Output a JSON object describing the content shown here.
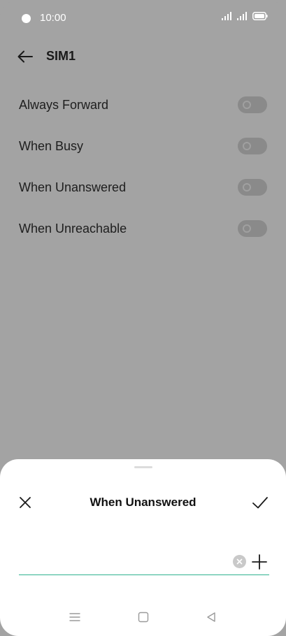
{
  "status_bar": {
    "time": "10:00",
    "icons": [
      "signal-icon",
      "signal-icon",
      "battery-icon"
    ]
  },
  "header": {
    "back_icon": "arrow-left-icon",
    "title": "SIM1"
  },
  "settings": {
    "items": [
      {
        "label": "Always Forward",
        "enabled": false
      },
      {
        "label": "When Busy",
        "enabled": false
      },
      {
        "label": "When Unanswered",
        "enabled": false
      },
      {
        "label": "When Unreachable",
        "enabled": false
      }
    ]
  },
  "sheet": {
    "title": "When Unanswered",
    "close_icon": "close-icon",
    "confirm_icon": "checkmark-icon",
    "number_value": "",
    "clear_icon": "clear-icon",
    "add_icon": "plus-icon",
    "accent_color": "#2fb38f"
  },
  "nav_bar": {
    "icons": [
      "menu-icon",
      "home-icon",
      "back-icon"
    ]
  }
}
